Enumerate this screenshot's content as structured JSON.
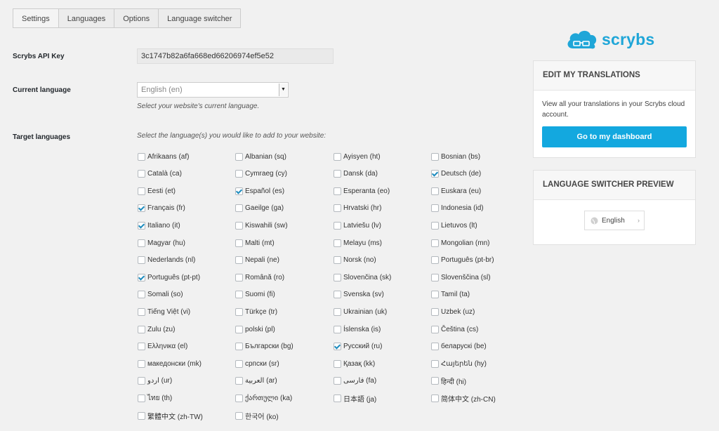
{
  "tabs": [
    "Settings",
    "Languages",
    "Options",
    "Language switcher"
  ],
  "api_key": {
    "label": "Scrybs API Key",
    "value": "3c1747b82a6fa668ed66206974ef5e52"
  },
  "current_language": {
    "label": "Current language",
    "value": "English (en)",
    "help": "Select your website's current language."
  },
  "target_languages": {
    "label": "Target languages",
    "help": "Select the language(s) you would like to add to your website:",
    "columns": [
      [
        {
          "name": "Afrikaans (af)",
          "checked": false
        },
        {
          "name": "Català (ca)",
          "checked": false
        },
        {
          "name": "Eesti (et)",
          "checked": false
        },
        {
          "name": "Français (fr)",
          "checked": true
        },
        {
          "name": "Italiano (it)",
          "checked": true
        },
        {
          "name": "Magyar (hu)",
          "checked": false
        },
        {
          "name": "Nederlands (nl)",
          "checked": false
        },
        {
          "name": "Português (pt-pt)",
          "checked": true
        },
        {
          "name": "Somali (so)",
          "checked": false
        },
        {
          "name": "Tiếng Việt (vi)",
          "checked": false
        },
        {
          "name": "Zulu (zu)",
          "checked": false
        },
        {
          "name": "Ελληνικα (el)",
          "checked": false
        },
        {
          "name": "македонски (mk)",
          "checked": false
        },
        {
          "name": "اردو (ur)",
          "checked": false
        },
        {
          "name": "ไทย (th)",
          "checked": false
        },
        {
          "name": "繁體中文 (zh-TW)",
          "checked": false
        }
      ],
      [
        {
          "name": "Albanian (sq)",
          "checked": false
        },
        {
          "name": "Cymraeg (cy)",
          "checked": false
        },
        {
          "name": "Español (es)",
          "checked": true
        },
        {
          "name": "Gaeilge (ga)",
          "checked": false
        },
        {
          "name": "Kiswahili (sw)",
          "checked": false
        },
        {
          "name": "Malti (mt)",
          "checked": false
        },
        {
          "name": "Nepali (ne)",
          "checked": false
        },
        {
          "name": "Română (ro)",
          "checked": false
        },
        {
          "name": "Suomi (fi)",
          "checked": false
        },
        {
          "name": "Türkçe (tr)",
          "checked": false
        },
        {
          "name": "polski (pl)",
          "checked": false
        },
        {
          "name": "Български (bg)",
          "checked": false
        },
        {
          "name": "српски (sr)",
          "checked": false
        },
        {
          "name": "العربية (ar)",
          "checked": false
        },
        {
          "name": "ქართული (ka)",
          "checked": false
        },
        {
          "name": "한국어 (ko)",
          "checked": false
        }
      ],
      [
        {
          "name": "Ayisyen (ht)",
          "checked": false
        },
        {
          "name": "Dansk (da)",
          "checked": false
        },
        {
          "name": "Esperanta (eo)",
          "checked": false
        },
        {
          "name": "Hrvatski (hr)",
          "checked": false
        },
        {
          "name": "Latviešu (lv)",
          "checked": false
        },
        {
          "name": "Melayu (ms)",
          "checked": false
        },
        {
          "name": "Norsk (no)",
          "checked": false
        },
        {
          "name": "Slovenčina (sk)",
          "checked": false
        },
        {
          "name": "Svenska (sv)",
          "checked": false
        },
        {
          "name": "Ukrainian (uk)",
          "checked": false
        },
        {
          "name": "Íslenska (is)",
          "checked": false
        },
        {
          "name": "Русский (ru)",
          "checked": true
        },
        {
          "name": "Қазақ (kk)",
          "checked": false
        },
        {
          "name": "فارسی (fa)",
          "checked": false
        },
        {
          "name": "日本語 (ja)",
          "checked": false
        }
      ],
      [
        {
          "name": "Bosnian (bs)",
          "checked": false
        },
        {
          "name": "Deutsch (de)",
          "checked": true
        },
        {
          "name": "Euskara (eu)",
          "checked": false
        },
        {
          "name": "Indonesia (id)",
          "checked": false
        },
        {
          "name": "Lietuvos (lt)",
          "checked": false
        },
        {
          "name": "Mongolian (mn)",
          "checked": false
        },
        {
          "name": "Português (pt-br)",
          "checked": false
        },
        {
          "name": "Slovenščina (sl)",
          "checked": false
        },
        {
          "name": "Tamil (ta)",
          "checked": false
        },
        {
          "name": "Uzbek (uz)",
          "checked": false
        },
        {
          "name": "Čeština (cs)",
          "checked": false
        },
        {
          "name": "беларускі (be)",
          "checked": false
        },
        {
          "name": "Հայերեն (hy)",
          "checked": false
        },
        {
          "name": "हिन्दी (hi)",
          "checked": false
        },
        {
          "name": "简体中文 (zh-CN)",
          "checked": false
        }
      ]
    ]
  },
  "logo": {
    "text": "scrybs",
    "color": "#1fa6d8"
  },
  "edit_panel": {
    "title": "EDIT MY TRANSLATIONS",
    "text": "View all your translations in your Scrybs cloud account.",
    "button": "Go to my dashboard",
    "button_color": "#13a8df"
  },
  "switcher_panel": {
    "title": "LANGUAGE SWITCHER PREVIEW",
    "value": "English"
  }
}
